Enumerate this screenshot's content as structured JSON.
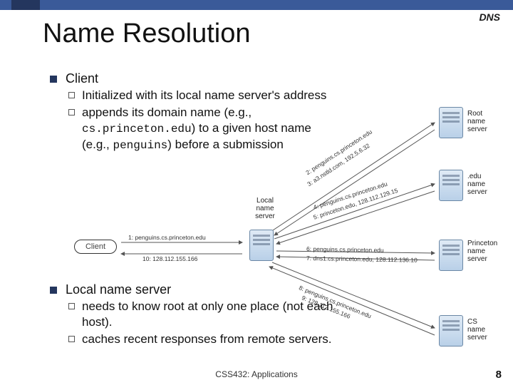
{
  "header": {
    "label": "DNS"
  },
  "title": "Name Resolution",
  "bullets": {
    "client": {
      "label": "Client",
      "subs": [
        {
          "text": "Initialized with its local name server's address"
        },
        {
          "prefix": "appends its domain name (e.g., ",
          "code1": "cs.princeton.edu",
          "mid": ") to a given host name (e.g., ",
          "code2": "penguins",
          "suffix": ") before a submission"
        }
      ]
    },
    "local": {
      "label": "Local name server",
      "subs": [
        {
          "text": "needs to know root at only one place (not each host)."
        },
        {
          "text": "caches recent responses from remote servers."
        }
      ]
    }
  },
  "diagram": {
    "local_label": "Local\nname\nserver",
    "client_label": "Client",
    "servers": {
      "root": "Root\nname\nserver",
      "edu": ".edu\nname\nserver",
      "princeton": "Princeton\nname\nserver",
      "cs": "CS\nname\nserver"
    },
    "msgs": {
      "m1": "1: penguins.cs.princeton.edu",
      "m10": "10: 128.112.155.166",
      "m2": "2: penguins.cs.princeton.edu",
      "m3": "3: a3.nstld.com, 192.5.6.32",
      "m4": "4: penguins.cs.princeton.edu",
      "m5": "5: princeton.edu, 128.112.129.15",
      "m6": "6: penguins.cs.princeton.edu",
      "m7": "7: dns1.cs.princeton.edu, 128.112.136.10",
      "m8": "8: penguins.cs.princeton.edu",
      "m9": "9: 128.112.155.166"
    }
  },
  "footer": "CSS432: Applications",
  "page": "8"
}
